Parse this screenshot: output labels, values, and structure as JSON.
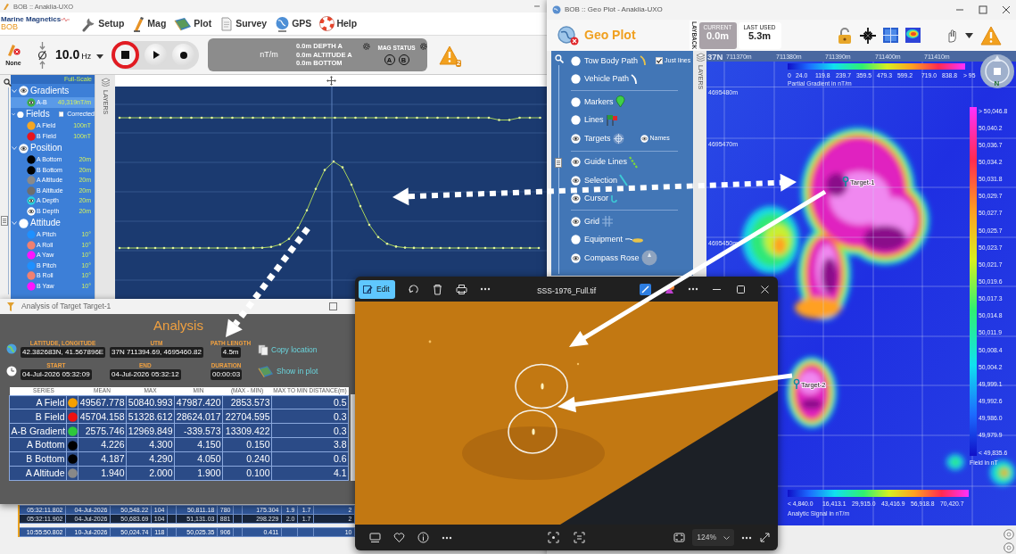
{
  "main_window": {
    "title": "BOB :: Anaklia-UXO",
    "logo": {
      "brand": "Marine Magnetics",
      "product": "BOB"
    },
    "menu": [
      {
        "label": "Setup"
      },
      {
        "label": "Mag"
      },
      {
        "label": "Plot"
      },
      {
        "label": "Survey"
      },
      {
        "label": "GPS"
      },
      {
        "label": "Help"
      }
    ],
    "toolbar": {
      "device_label": "None",
      "rate": "10.0",
      "rate_unit": "Hz",
      "status": {
        "gradient_unit": "nT/m",
        "readings": [
          "0.0m DEPTH A",
          "0.0m ALTITUDE A",
          "0.0m BOTTOM"
        ],
        "mag_status_label": "MAG STATUS",
        "sensors": [
          "A",
          "B"
        ]
      },
      "warning_count": "2"
    },
    "layers": {
      "scale_mode": "Full-Scale",
      "tab_label": "LAYERS",
      "groups": [
        {
          "label": "Gradients",
          "visible": true,
          "children": [
            {
              "label": "A-B",
              "scale": "40,319nT/m",
              "color": "#3cb54a",
              "visible": true,
              "selected": true
            }
          ]
        },
        {
          "label": "Fields",
          "visible": false,
          "option": {
            "label": "Corrected",
            "checked": false
          },
          "children": [
            {
              "label": "A Field",
              "scale": "100nT",
              "color": "#f5a623",
              "visible": false,
              "selected": false
            },
            {
              "label": "B Field",
              "scale": "100nT",
              "color": "#e8141c",
              "visible": false,
              "selected": false
            }
          ]
        },
        {
          "label": "Position",
          "visible": true,
          "children": [
            {
              "label": "A Bottom",
              "scale": "20m",
              "color": "#000000",
              "visible": false,
              "selected": false
            },
            {
              "label": "B Bottom",
              "scale": "20m",
              "color": "#000000",
              "visible": false,
              "selected": false
            },
            {
              "label": "A Altitude",
              "scale": "20m",
              "color": "#8a8a8a",
              "visible": false,
              "selected": false
            },
            {
              "label": "B Altitude",
              "scale": "20m",
              "color": "#6e6e6e",
              "visible": false,
              "selected": false
            },
            {
              "label": "A Depth",
              "scale": "20m",
              "color": "#2ad4e0",
              "visible": true,
              "selected": false
            },
            {
              "label": "B Depth",
              "scale": "20m",
              "color": "#ffffff",
              "visible": true,
              "selected": false
            }
          ]
        },
        {
          "label": "Attitude",
          "visible": false,
          "children": [
            {
              "label": "A Pitch",
              "scale": "10°",
              "color": "#1e90ff",
              "visible": false,
              "selected": false
            },
            {
              "label": "A Roll",
              "scale": "10°",
              "color": "#f08070",
              "visible": false,
              "selected": false
            },
            {
              "label": "A Yaw",
              "scale": "10°",
              "color": "#ff14ff",
              "visible": false,
              "selected": false
            },
            {
              "label": "B Pitch",
              "scale": "10°",
              "color": "#1e90ff",
              "visible": false,
              "selected": false
            },
            {
              "label": "B Roll",
              "scale": "10°",
              "color": "#f08070",
              "visible": false,
              "selected": false
            },
            {
              "label": "B Yaw",
              "scale": "10°",
              "color": "#ff14ff",
              "visible": false,
              "selected": false
            }
          ]
        }
      ]
    },
    "log_table": {
      "rows": [
        {
          "selected": false,
          "column_1": "05:32:11.802",
          "column_2": "04-Jul-2026",
          "column_3": "50,548.22",
          "column_4": "104",
          "column_6": "50,811.18",
          "column_7": "780",
          "column_9": "175.304",
          "column_10": "1.9",
          "column_11": "1.7",
          "column_12": "2"
        },
        {
          "selected": true,
          "column_1": "05:32:11.902",
          "column_2": "04-Jul-2026",
          "column_3": "50,683.69",
          "column_4": "104",
          "column_6": "51,131.03",
          "column_7": "881",
          "column_9": "298.229",
          "column_10": "2.0",
          "column_11": "1.7",
          "column_12": "2"
        },
        {
          "selected": false,
          "column_1": "10:55:50.802",
          "column_2": "10-Jul-2026",
          "column_3": "50,024.74",
          "column_4": "118",
          "column_6": "50,025.35",
          "column_7": "906",
          "column_9": "0.411",
          "column_12": "10"
        }
      ]
    }
  },
  "analysis_window": {
    "title": "Analysis of Target Target-1",
    "heading": "Analysis",
    "fields": [
      {
        "label": "LATITUDE, LONGITUDE",
        "value": "42.382683N, 41.567896E"
      },
      {
        "label": "UTM",
        "value": "37N 711394.69, 4695460.82"
      },
      {
        "label": "PATH LENGTH",
        "value": "4.5m"
      },
      {
        "label": "START",
        "value": "04-Jul-2026 05:32:09"
      },
      {
        "label": "END",
        "value": "04-Jul-2026 05:32:12"
      },
      {
        "label": "DURATION",
        "value": "00:00:03"
      }
    ],
    "actions": [
      {
        "label": "Copy location"
      },
      {
        "label": "Show in plot"
      }
    ],
    "table": {
      "columns": [
        "SERIES",
        "MEAN",
        "MAX",
        "MIN",
        "(MAX - MIN)",
        "MAX TO MIN DISTANCE(m)"
      ],
      "rows": [
        {
          "series": "A Field",
          "color": "#f5a000",
          "values": [
            "49567.778",
            "50840.993",
            "47987.420",
            "2853.573",
            "0.5"
          ]
        },
        {
          "series": "B Field",
          "color": "#ee1111",
          "values": [
            "45704.158",
            "51328.612",
            "28624.017",
            "22704.595",
            "0.3"
          ]
        },
        {
          "series": "A-B Gradient",
          "color": "#2ec83c",
          "values": [
            "2575.746",
            "12969.849",
            "-339.573",
            "13309.422",
            "0.3"
          ]
        },
        {
          "series": "A Bottom",
          "color": "#000000",
          "values": [
            "4.226",
            "4.300",
            "4.150",
            "0.150",
            "3.8"
          ]
        },
        {
          "series": "B Bottom",
          "color": "#000000",
          "values": [
            "4.187",
            "4.290",
            "4.050",
            "0.240",
            "0.6"
          ]
        },
        {
          "series": "A Altitude",
          "color": "#888888",
          "values": [
            "1.940",
            "2.000",
            "1.900",
            "0.100",
            "4.1"
          ]
        }
      ]
    }
  },
  "geo_plot_window": {
    "title": "BOB :: Geo Plot - Anaklia-UXO",
    "heading": "Geo Plot",
    "layback": {
      "label": "LAYBACK",
      "options": [
        {
          "label": "CURRENT",
          "value": "0.0m",
          "selected": true
        },
        {
          "label": "LAST USED",
          "value": "5.3m",
          "selected": false
        }
      ]
    },
    "layers_tab": "LAYERS",
    "layer_sections": [
      [
        {
          "label": "Tow Body Path",
          "visible": false,
          "option": {
            "kind": "checkbox",
            "label": "Just lines",
            "checked": true
          }
        },
        {
          "label": "Vehicle Path",
          "visible": false
        }
      ],
      [
        {
          "label": "Markers",
          "visible": false
        },
        {
          "label": "Lines",
          "visible": false
        },
        {
          "label": "Targets",
          "visible": true,
          "option": {
            "kind": "eye",
            "label": "Names",
            "visible": true
          }
        }
      ],
      [
        {
          "label": "Guide Lines",
          "visible": true
        },
        {
          "label": "Selection",
          "visible": true
        },
        {
          "label": "Cursor",
          "visible": true
        }
      ],
      [
        {
          "label": "Grid",
          "visible": true
        },
        {
          "label": "Equipment",
          "visible": false
        },
        {
          "label": "Compass Rose",
          "visible": true
        }
      ]
    ],
    "map": {
      "zone": "37N",
      "x_ticks": [
        "711370m",
        "711380m",
        "711390m",
        "711400m",
        "711410m"
      ],
      "y_ticks": [
        "4695480m",
        "4695470m",
        "4695450m"
      ],
      "compass_label": "N",
      "targets": [
        {
          "label": "Target-1"
        },
        {
          "label": "Target-2"
        }
      ],
      "gradient_scale": {
        "title": "Partial Gradient in nT/m",
        "labels": [
          "0",
          "24.0",
          "119.8",
          "239.7",
          "359.5",
          "479.3",
          "599.2",
          "719.0",
          "838.8",
          "> 95"
        ]
      },
      "field_scale": {
        "title": "Field in nT",
        "labels": [
          "> 50,046.8",
          "50,040.2",
          "50,036.7",
          "50,034.2",
          "50,031.8",
          "50,029.7",
          "50,027.7",
          "50,025.7",
          "50,023.7",
          "50,021.7",
          "50,019.6",
          "50,017.3",
          "50,014.8",
          "50,011.9",
          "50,008.4",
          "50,004.2",
          "49,999.1",
          "49,992.6",
          "49,986.0",
          "49,979.9",
          "< 49,835.6"
        ]
      },
      "signal_scale": {
        "title": "Analytic Signal in nT/m",
        "labels": [
          "< 4,840.0",
          "16,413.1",
          "29,915.0",
          "43,416.9",
          "56,918.8",
          "70,420.7"
        ]
      }
    }
  },
  "photo_viewer": {
    "file_name": "SSS-1976_Full.tif",
    "edit_label": "Edit",
    "zoom_level": "124%"
  }
}
